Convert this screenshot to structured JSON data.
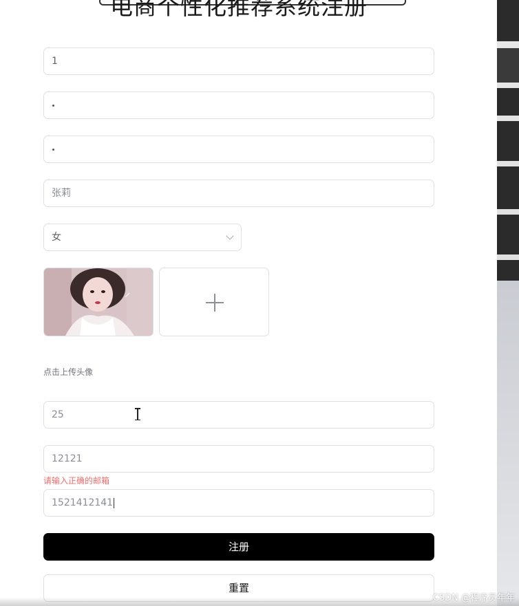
{
  "title": "电商个性化推荐系统注册",
  "form": {
    "username_value": "1",
    "password_mask": "•",
    "confirm_password_mask": "•",
    "name_value": "张莉",
    "gender_selected": "女",
    "avatar_upload_tip": "点击上传头像",
    "age_value": "25",
    "email_value": "12121",
    "email_error": "请输入正确的邮箱",
    "phone_value": "1521412141"
  },
  "buttons": {
    "register_label": "注册",
    "reset_label": "重置"
  },
  "watermark": "CSDN @程序员年年",
  "icons": {
    "gender_chevron": "chevron-down-icon",
    "upload_plus": "plus-icon"
  },
  "colors": {
    "primary_button": "#000000",
    "error": "#f56c6c",
    "border": "#dcdfe6"
  }
}
